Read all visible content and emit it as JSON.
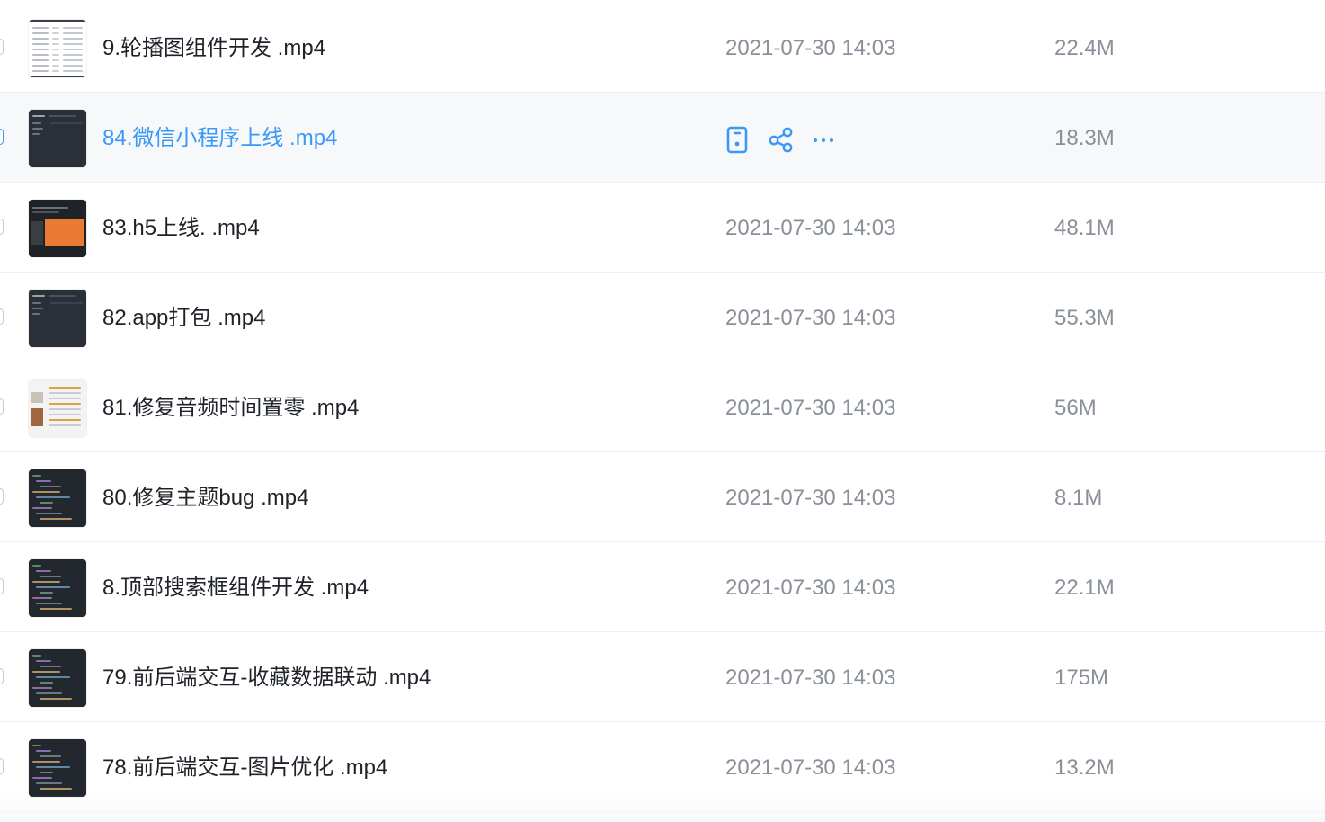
{
  "files": [
    {
      "name": "9.轮播图组件开发 .mp4",
      "modified": "2021-07-30 14:03",
      "size": "22.4M",
      "thumb": "light-table"
    },
    {
      "name": "84.微信小程序上线 .mp4",
      "modified": "",
      "size": "18.3M",
      "thumb": "dark-panel",
      "hovered": true
    },
    {
      "name": "83.h5上线. .mp4",
      "modified": "2021-07-30 14:03",
      "size": "48.1M",
      "thumb": "orange-banner"
    },
    {
      "name": "82.app打包 .mp4",
      "modified": "2021-07-30 14:03",
      "size": "55.3M",
      "thumb": "dark-panel"
    },
    {
      "name": "81.修复音频时间置零 .mp4",
      "modified": "2021-07-30 14:03",
      "size": "56M",
      "thumb": "light-mixed"
    },
    {
      "name": "80.修复主题bug .mp4",
      "modified": "2021-07-30 14:03",
      "size": "8.1M",
      "thumb": "dark-code"
    },
    {
      "name": "8.顶部搜索框组件开发 .mp4",
      "modified": "2021-07-30 14:03",
      "size": "22.1M",
      "thumb": "dark-code"
    },
    {
      "name": "79.前后端交互-收藏数据联动 .mp4",
      "modified": "2021-07-30 14:03",
      "size": "175M",
      "thumb": "dark-code"
    },
    {
      "name": "78.前后端交互-图片优化 .mp4",
      "modified": "2021-07-30 14:03",
      "size": "13.2M",
      "thumb": "dark-code"
    }
  ],
  "hover_actions": [
    "phone-transfer-icon",
    "share-icon",
    "more-icon"
  ],
  "colors": {
    "accent": "#3b99f6",
    "text": "#1f2329",
    "muted": "#8a9099",
    "hover_row": "#f7f8fa",
    "divider": "#eceff3"
  }
}
